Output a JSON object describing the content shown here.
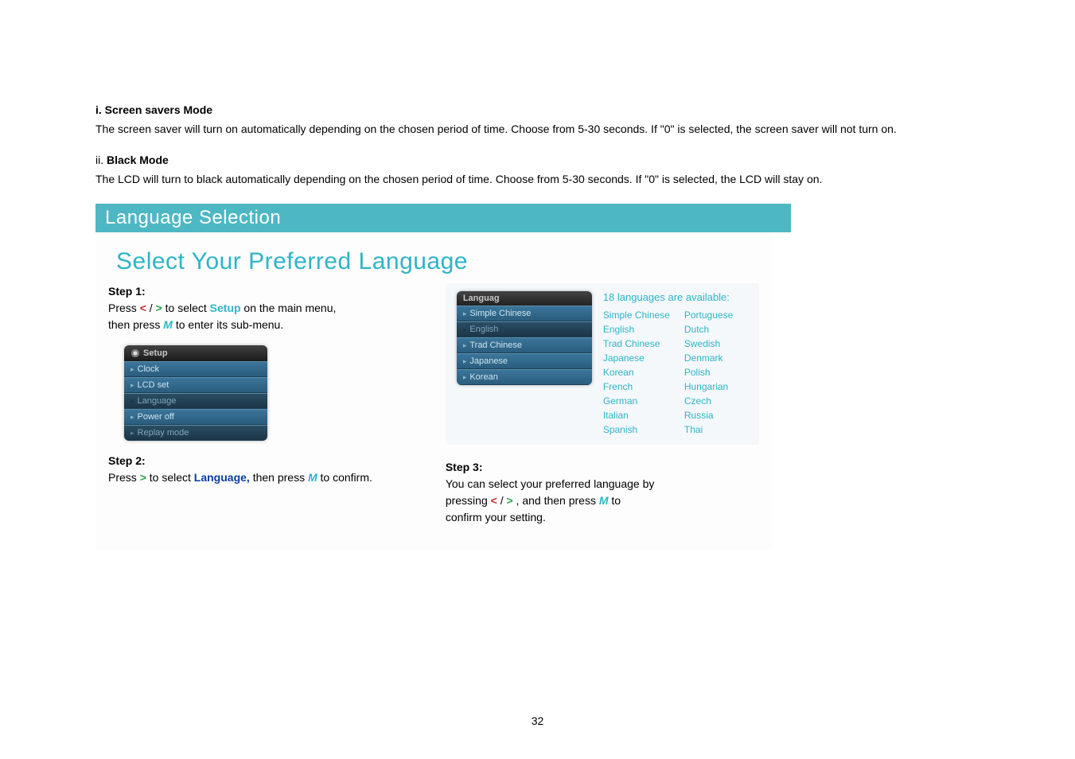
{
  "sections": {
    "screen_savers": {
      "heading": "i. Screen savers Mode",
      "body": "The screen saver will turn on automatically depending on the chosen period of time. Choose from 5-30 seconds. If \"0\" is selected, the screen saver will not turn on."
    },
    "black_mode": {
      "heading_prefix": "ii. ",
      "heading": "Black Mode",
      "body": "The LCD will turn to black automatically depending on the chosen period of time. Choose from 5-30 seconds. If \"0\" is selected, the LCD will stay on."
    }
  },
  "banner": "Language Selection",
  "title": "Select Your Preferred Language",
  "step1": {
    "label": "Step 1:",
    "part1": "Press ",
    "lt": "<",
    "slash": " / ",
    "gt": ">",
    "part2": " to select ",
    "setup_word": "Setup",
    "part3": " on the main menu,",
    "line2a": "then press ",
    "m": "M",
    "line2b": " to enter its sub-menu."
  },
  "setup_menu": {
    "header": "Setup",
    "items": [
      "Clock",
      "LCD set",
      "Language",
      "Power off",
      "Replay mode"
    ],
    "selected_index": 2
  },
  "step2": {
    "label": "Step 2:",
    "part1": "Press ",
    "gt": ">",
    "part2": " to select ",
    "lang_word": "Language,",
    "part3": " then press ",
    "m": "M",
    "part4": " to confirm."
  },
  "lang_menu": {
    "header": "Languag",
    "items": [
      "Simple Chinese",
      "English",
      "Trad Chinese",
      "Japanese",
      "Korean"
    ],
    "selected_index": 1
  },
  "available": {
    "caption": "18 languages are available:",
    "col1": [
      "Simple Chinese",
      "English",
      "Trad Chinese",
      "Japanese",
      "Korean",
      "French",
      "German",
      "Italian",
      "Spanish"
    ],
    "col2": [
      "Portuguese",
      "Dutch",
      "Swedish",
      "Denmark",
      "Polish",
      "Hungarian",
      "Czech",
      "Russia",
      "Thai"
    ]
  },
  "step3": {
    "label": "Step 3:",
    "line1": "You can select your preferred language by",
    "part1": "pressing ",
    "lt": "<",
    "slash": " / ",
    "gt": ">",
    "part2": " , and then press ",
    "m": "M",
    "part3": " to",
    "line3": "confirm your setting."
  },
  "page_number": "32"
}
